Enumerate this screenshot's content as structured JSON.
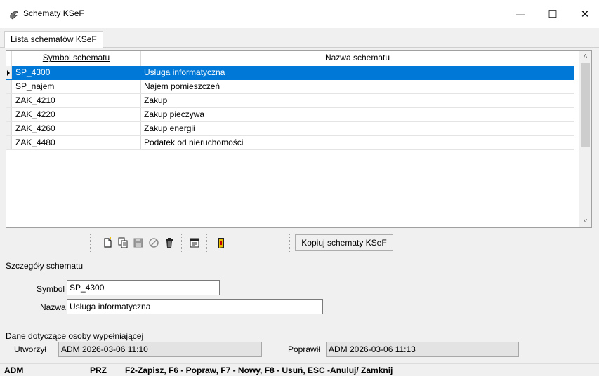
{
  "window": {
    "title": "Schematy KSeF",
    "minimize_glyph": "—",
    "maximize_glyph": "☐",
    "close_glyph": "✕"
  },
  "tab": {
    "label": "Lista schematów KSeF"
  },
  "grid": {
    "columns": [
      "Symbol schematu",
      "Nazwa schematu"
    ],
    "rows": [
      {
        "symbol": "SP_4300",
        "name": "Usługa informatyczna",
        "selected": true
      },
      {
        "symbol": "SP_najem",
        "name": "Najem pomieszczeń",
        "selected": false
      },
      {
        "symbol": "ZAK_4210",
        "name": "Zakup",
        "selected": false
      },
      {
        "symbol": "ZAK_4220",
        "name": "Zakup pieczywa",
        "selected": false
      },
      {
        "symbol": "ZAK_4260",
        "name": "Zakup energii",
        "selected": false
      },
      {
        "symbol": "ZAK_4480",
        "name": "Podatek od nieruchomości",
        "selected": false
      }
    ],
    "scroll_up_glyph": "˄",
    "scroll_down_glyph": "˅"
  },
  "toolbar": {
    "icons": [
      "new-document-icon",
      "copy-document-icon",
      "save-icon",
      "cancel-icon",
      "delete-trash-icon",
      "properties-icon",
      "exit-door-icon"
    ],
    "copy_button_label": "Kopiuj schematy KSeF"
  },
  "details": {
    "group_title": "Szczegóły schematu",
    "symbol_label": "Symbol",
    "symbol_value": "SP_4300",
    "name_label": "Nazwa",
    "name_value": "Usługa informatyczna"
  },
  "audit": {
    "group_title": "Dane dotyczące osoby wypełniającej",
    "created_label": "Utworzył",
    "created_value": "ADM 2026-03-06 11:10",
    "modified_label": "Poprawił",
    "modified_value": "ADM 2026-03-06 11:13"
  },
  "status": {
    "user": "ADM",
    "mode": "PRZ",
    "hints": "F2-Zapisz,  F6 - Popraw, F7 - Nowy, F8 - Usuń, ESC -Anuluj/ Zamknij"
  },
  "colors": {
    "selection": "#0078d7",
    "background": "#f0f0f0"
  }
}
